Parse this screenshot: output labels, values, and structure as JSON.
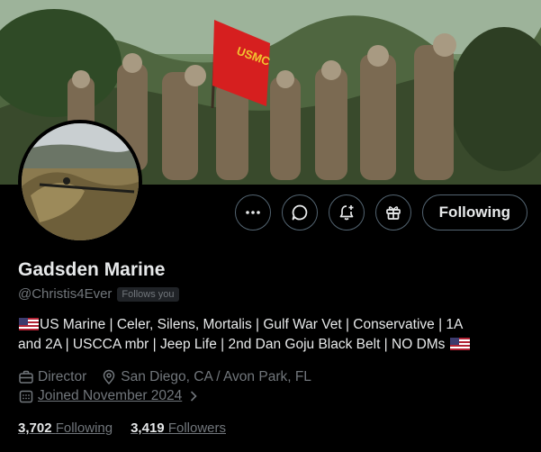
{
  "profile": {
    "name": "Gadsden Marine",
    "handle": "@Christis4Ever",
    "follows_you": "Follows you",
    "bio_line1": "US Marine | Celer, Silens, Mortalis | Gulf War Vet | Conservative | 1A",
    "bio_line2": "and 2A | USCCA mbr | Jeep Life | 2nd Dan Goju Black Belt | NO DMs",
    "occupation": "Director",
    "location": "San Diego, CA / Avon Park, FL",
    "joined": "Joined November 2024",
    "following_count": "3,702",
    "following_label": "Following",
    "followers_count": "3,419",
    "followers_label": "Followers"
  },
  "banner": {
    "flag_text": "USMC"
  },
  "actions": {
    "more_icon": "more-icon",
    "message_icon": "message-icon",
    "notify_icon": "bell-plus-icon",
    "subscribe_icon": "gift-icon",
    "follow_label": "Following"
  },
  "colors": {
    "background": "#000000",
    "text": "#e7e9ea",
    "muted": "#71767b",
    "border": "#536471",
    "flag_red": "#d61f1f"
  }
}
